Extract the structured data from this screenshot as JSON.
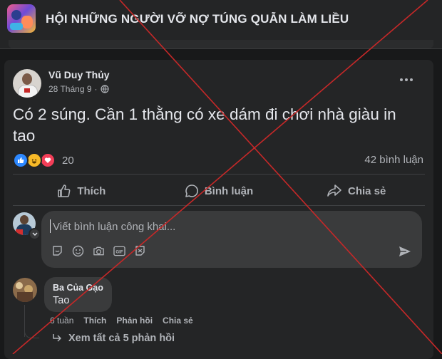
{
  "group": {
    "name": "HỘI NHỮNG NGƯỜI VỠ NỢ TÚNG QUẪN LÀM LIỀU"
  },
  "post": {
    "author": "Vũ Duy Thủy",
    "date": "28 Tháng 9",
    "text": "Có 2 súng. Cần 1 thằng có xe dám đi chơi nhà giàu in tao",
    "reaction_count": "20",
    "comment_count": "42 bình luận"
  },
  "actions": {
    "like": "Thích",
    "comment": "Bình luận",
    "share": "Chia sẻ"
  },
  "composer": {
    "placeholder": "Viết bình luận công khai..."
  },
  "comment": {
    "name": "Ba Của Gạo",
    "text": "Tao",
    "time": "6 tuần",
    "like": "Thích",
    "reply": "Phản hồi",
    "share": "Chia sẻ",
    "view_replies": "Xem tất cả 5 phản hồi"
  },
  "colors": {
    "overlay": "#c62828",
    "like": "#2d88ff",
    "haha": "#f7b928",
    "love": "#f33e58"
  },
  "icons": [
    "globe-icon",
    "more-icon",
    "like-icon",
    "haha-icon",
    "love-icon",
    "thumbs-up-icon",
    "comment-icon",
    "share-icon",
    "sticker-icon",
    "emoji-icon",
    "camera-icon",
    "gif-icon",
    "avatar-sticker-icon",
    "send-icon",
    "reply-arrow-icon",
    "chevron-down-icon"
  ]
}
